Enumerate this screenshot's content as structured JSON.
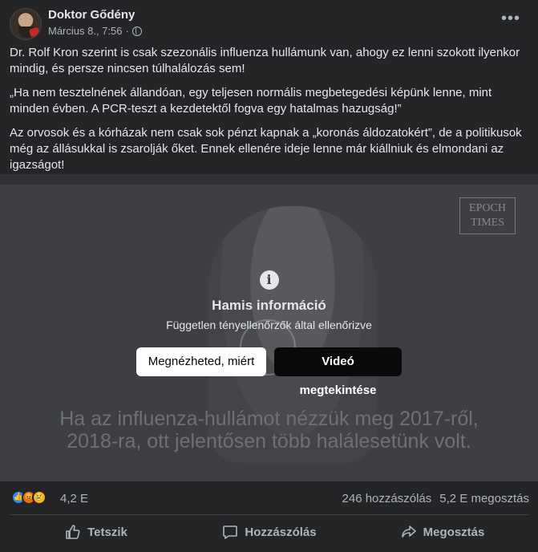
{
  "post": {
    "author": "Doktor Gődény",
    "timestamp": "Március 8., 7:56",
    "meta_separator": "·",
    "more_label": "•••",
    "paragraphs": [
      "Dr. Rolf Kron szerint is csak szezonális influenza hullámunk van, ahogy ez lenni szokott ilyenkor mindig, és persze nincsen túlhalálozás sem!",
      "„Ha nem tesztelnének állandóan, egy teljesen normális megbetegedési képünk lenne, mint minden évben. A PCR-teszt a kezdetektől fogva egy hatalmas hazugság!”",
      "Az orvosok és a kórházak nem csak sok pénzt kapnak a „koronás áldozatokért”, de a politikusok még az állásukkal is zsarolják őket. Ennek ellenére ideje lenne már kiállniuk és elmondani az igazságot!"
    ]
  },
  "media": {
    "watermark_line1": "EPOCH",
    "watermark_line2": "TIMES",
    "subtitle_line1": "Ha az influenza-hullámot nézzük meg 2017-ről,",
    "subtitle_line2": "2018-ra, ott jelentősen több halálesetünk volt.",
    "info_icon_glyph": "i",
    "false_info_title": "Hamis információ",
    "false_info_subtitle": "Független tényellenőrzők által ellenőrizve",
    "why_button": "Megnézheted, miért",
    "view_button": "Videó megtekintése"
  },
  "stats": {
    "reactions": [
      "like",
      "angry",
      "sad"
    ],
    "reaction_count": "4,2 E",
    "comments": "246 hozzászólás",
    "shares": "5,2 E megosztás"
  },
  "actions": {
    "like": "Tetszik",
    "comment": "Hozzászólás",
    "share": "Megosztás"
  },
  "colors": {
    "background": "#242526",
    "text_primary": "#e4e6eb",
    "text_secondary": "#b0b3b8",
    "like_blue": "#2d88ff"
  }
}
